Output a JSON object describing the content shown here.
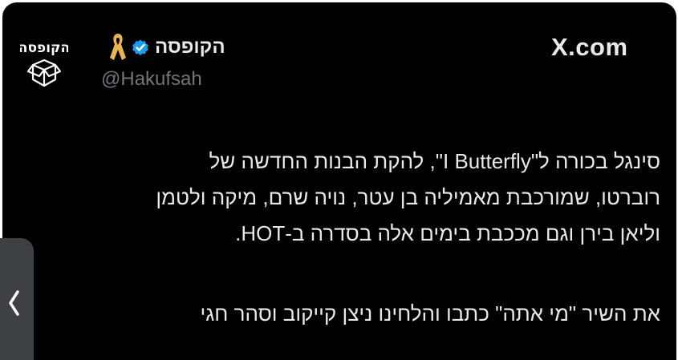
{
  "header": {
    "site_label": "X.com",
    "display_name": "הקופסה",
    "handle": "@Hakufsah",
    "avatar_text": "הקופסה"
  },
  "tweet": {
    "paragraph1": [
      "סינגל בכורה ל\"I Butterfly\", להקת הבנות החדשה של",
      "רוברטו, שמורכבת מאמיליה בן עטר, נויה שרם, מיקה ולטמן",
      "וליאן בירן וגם מככבת בימים אלה בסדרה ב-HOT."
    ],
    "paragraph2": [
      "את השיר \"מי אתה\" כתבו והלחינו ניצן קייקוב וסהר חגי"
    ]
  },
  "icons": {
    "verified": "verified-badge-icon",
    "ribbon": "yellow-ribbon-icon",
    "nav": "chevron-left-icon"
  },
  "colors": {
    "background": "#000000",
    "text": "#e7e9ea",
    "muted": "#71767b",
    "verified": "#1d9bf0",
    "ribbon": "#e8b84a"
  }
}
